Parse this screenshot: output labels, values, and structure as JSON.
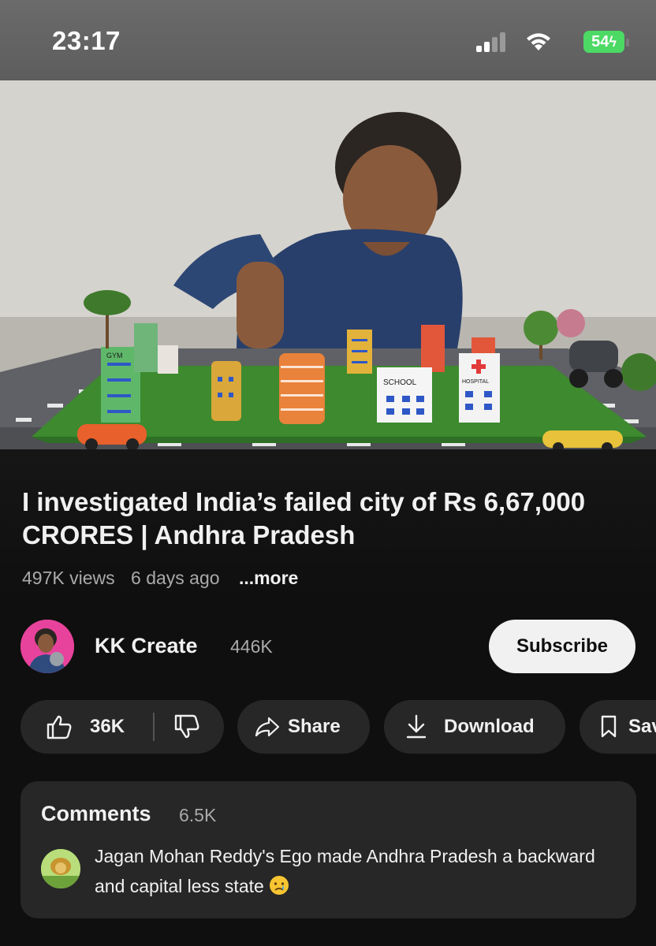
{
  "status_bar": {
    "time": "23:17",
    "battery_level": "54",
    "battery_color": "#4cd964",
    "icons": [
      "signal-icon",
      "wifi-icon",
      "battery-charging-icon"
    ]
  },
  "video": {
    "thumbnail_labels": [
      "GYM",
      "SCHOOL",
      "HOSPITAL"
    ]
  },
  "details": {
    "title": "I investigated India’s failed city of Rs 6,67,000 CRORES | Andhra Pradesh",
    "views": "497K views",
    "age": "6 days ago",
    "more": "...more"
  },
  "channel": {
    "name": "KK Create",
    "subscribers": "446K",
    "subscribe_label": "Subscribe",
    "accent": "#e8439c"
  },
  "actions": {
    "like_count": "36K",
    "share_label": "Share",
    "download_label": "Download",
    "save_label": "Save",
    "icons": [
      "thumbs-up-icon",
      "thumbs-down-icon",
      "share-arrow-icon",
      "download-icon",
      "bookmark-icon"
    ]
  },
  "comments": {
    "title": "Comments",
    "count": "6.5K",
    "top_comment_text": "Jagan Mohan Reddy's Ego made Andhra Pradesh a backward and capital less state",
    "top_comment_emoji": "crying-face-icon"
  }
}
